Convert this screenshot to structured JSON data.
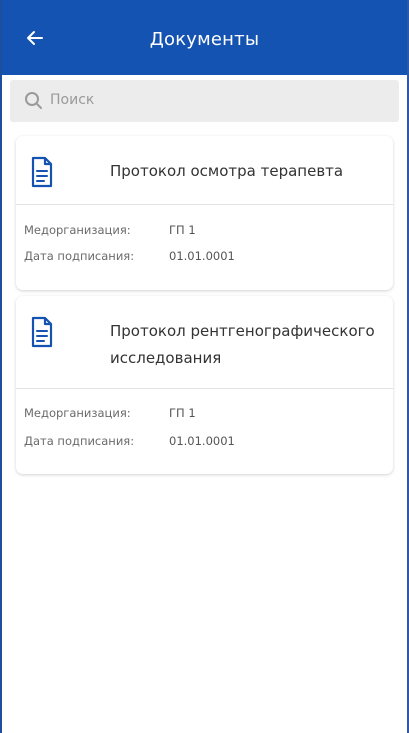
{
  "header": {
    "title": "Документы",
    "back_icon": "arrow-left-icon"
  },
  "search": {
    "placeholder": "Поиск",
    "icon": "search-icon"
  },
  "documents": [
    {
      "title": "Протокол осмотра терапевта",
      "icon": "document-icon",
      "org_label": "Медорганизация:",
      "org_value": "ГП 1",
      "date_label": "Дата подписания:",
      "date_value": "01.01.0001"
    },
    {
      "title": "Протокол рентгенографического исследования",
      "icon": "document-icon",
      "org_label": "Медорганизация:",
      "org_value": "ГП 1",
      "date_label": "Дата подписания:",
      "date_value": "01.01.0001"
    }
  ],
  "colors": {
    "header_bg": "#1553b2",
    "icon_blue": "#1553b2",
    "search_bg": "#ececec"
  }
}
